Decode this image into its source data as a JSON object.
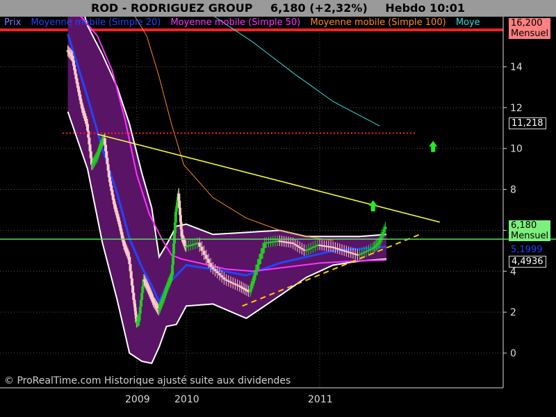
{
  "header": {
    "symbol": "ROD - RODRIGUEZ GROUP",
    "price_change": "6,180 (+2,32%)",
    "period_time": "Hebdo  10:01"
  },
  "legend": [
    {
      "label": "Prix",
      "color": "#7a7aff"
    },
    {
      "label": "Moyenne mobile (Simple 20)",
      "color": "#2244ff"
    },
    {
      "label": "Moyenne mobile (Simple 50)",
      "color": "#ff33ff"
    },
    {
      "label": "Moyenne mobile (Simple 100)",
      "color": "#ff8c1a"
    },
    {
      "label": "Moye",
      "color": "#33dddd"
    }
  ],
  "right_tags": {
    "top": {
      "value": "16,200",
      "sub": "Mensuel"
    },
    "resistance": "11,218",
    "last": {
      "value": "6,180",
      "sub": "Mensuel"
    },
    "ma_a": "5,1999",
    "ma_b": "4,4936"
  },
  "footer": "© ProRealTime.com Historique ajusté suite aux dividendes",
  "colors": {
    "background": "#000000",
    "bollinger_fill": "#5a1466",
    "bollinger_edge": "#ffffff",
    "ma20": "#2244ff",
    "ma50": "#ff33ff",
    "ma100": "#ff8c1a",
    "ma_long": "#33dddd",
    "trend_down": "#ffff33",
    "support": "#ffcc00",
    "resistance_line": "#ff2222",
    "price_line": "#44ee44",
    "arrow": "#22ee22"
  },
  "chart_data": {
    "type": "candlestick",
    "title": "ROD - RODRIGUEZ GROUP",
    "period": "Hebdo",
    "ylim": [
      -0.5,
      16.5
    ],
    "y_ticks": [
      0,
      2,
      4,
      6,
      8,
      10,
      12,
      14
    ],
    "x_ticks": [
      "2009",
      "2010",
      "2011"
    ],
    "x_tick_positions": [
      2009.0,
      2010.0,
      2011.0
    ],
    "xlim": [
      2007.55,
      2012.05
    ],
    "price_series_approx": [
      [
        2007.6,
        14.8
      ],
      [
        2007.7,
        14.5
      ],
      [
        2007.8,
        13.2
      ],
      [
        2007.9,
        12.0
      ],
      [
        2008.0,
        11.2
      ],
      [
        2008.1,
        9.2
      ],
      [
        2008.2,
        9.6
      ],
      [
        2008.3,
        10.3
      ],
      [
        2008.35,
        10.5
      ],
      [
        2008.45,
        8.6
      ],
      [
        2008.55,
        7.3
      ],
      [
        2008.65,
        6.4
      ],
      [
        2008.75,
        5.3
      ],
      [
        2008.85,
        4.7
      ],
      [
        2008.95,
        2.6
      ],
      [
        2009.0,
        1.5
      ],
      [
        2009.05,
        1.6
      ],
      [
        2009.15,
        3.6
      ],
      [
        2009.25,
        3.1
      ],
      [
        2009.35,
        2.5
      ],
      [
        2009.45,
        2.1
      ],
      [
        2009.55,
        2.7
      ],
      [
        2009.65,
        3.4
      ],
      [
        2009.72,
        3.8
      ],
      [
        2009.8,
        6.9
      ],
      [
        2009.85,
        7.8
      ],
      [
        2009.92,
        5.7
      ],
      [
        2010.0,
        5.2
      ],
      [
        2010.1,
        5.4
      ],
      [
        2010.2,
        4.2
      ],
      [
        2010.3,
        3.6
      ],
      [
        2010.4,
        3.3
      ],
      [
        2010.48,
        3.0
      ],
      [
        2010.52,
        3.8
      ],
      [
        2010.6,
        5.4
      ],
      [
        2010.7,
        5.5
      ],
      [
        2010.8,
        5.4
      ],
      [
        2010.9,
        5.0
      ],
      [
        2011.0,
        5.3
      ],
      [
        2011.1,
        5.2
      ],
      [
        2011.2,
        5.0
      ],
      [
        2011.3,
        4.8
      ],
      [
        2011.4,
        5.1
      ],
      [
        2011.45,
        5.4
      ],
      [
        2011.5,
        6.18
      ]
    ],
    "series": [
      {
        "name": "Moyenne mobile (Simple 20)",
        "points": [
          [
            2007.6,
            15.6
          ],
          [
            2008.0,
            12.5
          ],
          [
            2008.3,
            10.0
          ],
          [
            2008.6,
            7.8
          ],
          [
            2008.85,
            5.6
          ],
          [
            2009.1,
            4.2
          ],
          [
            2009.3,
            3.3
          ],
          [
            2009.45,
            2.5
          ],
          [
            2009.6,
            3.3
          ],
          [
            2009.8,
            3.8
          ],
          [
            2010.0,
            4.3
          ],
          [
            2010.2,
            4.1
          ],
          [
            2010.45,
            3.8
          ],
          [
            2010.7,
            4.4
          ],
          [
            2010.9,
            4.7
          ],
          [
            2011.1,
            5.0
          ],
          [
            2011.3,
            5.1
          ],
          [
            2011.5,
            5.2
          ]
        ]
      },
      {
        "name": "Moyenne mobile (Simple 50)",
        "points": [
          [
            2007.85,
            16.5
          ],
          [
            2008.2,
            15.5
          ],
          [
            2008.5,
            13.8
          ],
          [
            2008.75,
            11.5
          ],
          [
            2009.0,
            8.7
          ],
          [
            2009.25,
            6.8
          ],
          [
            2009.5,
            5.6
          ],
          [
            2009.7,
            4.8
          ],
          [
            2009.9,
            4.6
          ],
          [
            2010.1,
            4.4
          ],
          [
            2010.3,
            4.1
          ],
          [
            2010.5,
            4.0
          ],
          [
            2010.75,
            4.2
          ],
          [
            2011.0,
            4.4
          ],
          [
            2011.25,
            4.5
          ],
          [
            2011.5,
            4.55
          ]
        ]
      },
      {
        "name": "Moyenne mobile (Simple 100)",
        "points": [
          [
            2008.95,
            16.5
          ],
          [
            2009.2,
            15.5
          ],
          [
            2009.45,
            13.5
          ],
          [
            2009.7,
            11.2
          ],
          [
            2009.95,
            9.2
          ],
          [
            2010.2,
            7.6
          ],
          [
            2010.45,
            6.6
          ],
          [
            2010.7,
            6.0
          ],
          [
            2010.9,
            5.7
          ],
          [
            2011.1,
            5.5
          ]
        ]
      },
      {
        "name": "Moye",
        "points": [
          [
            2010.2,
            16.5
          ],
          [
            2010.5,
            15.2
          ],
          [
            2010.8,
            13.7
          ],
          [
            2011.1,
            12.3
          ],
          [
            2011.45,
            11.1
          ]
        ]
      }
    ],
    "annotations": {
      "downtrend_line": [
        [
          2008.2,
          10.7
        ],
        [
          2011.9,
          6.4
        ]
      ],
      "support_line": [
        [
          2010.42,
          2.3
        ],
        [
          2011.75,
          5.8
        ]
      ],
      "resistance_level": 10.75,
      "current_price": 6.18,
      "arrows_up": [
        [
          2011.85,
          10.1
        ],
        [
          2011.4,
          7.2
        ]
      ]
    }
  }
}
